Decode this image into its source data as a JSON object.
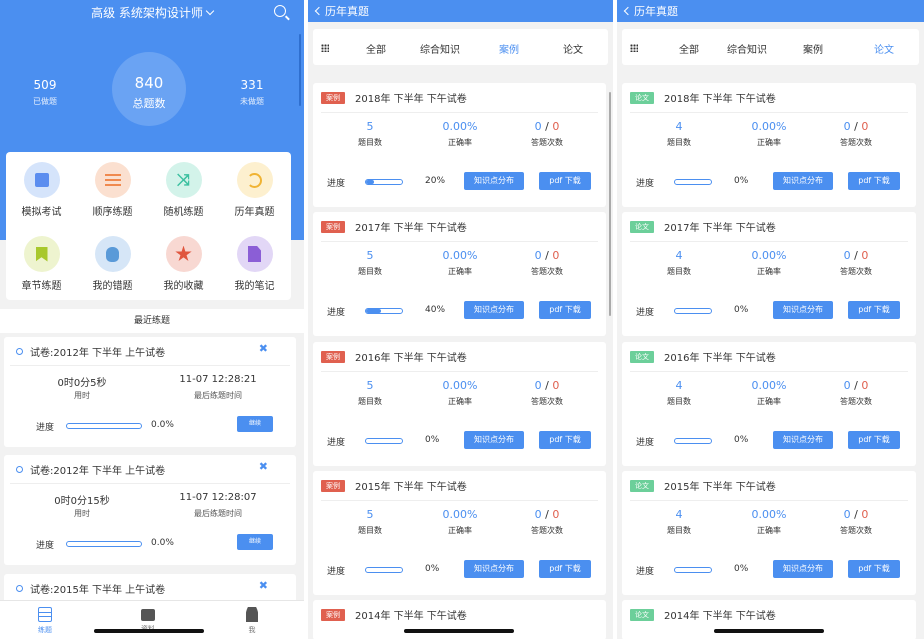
{
  "screen1": {
    "header_title": "高级 系统架构设计师",
    "stats": {
      "total_value": "840",
      "total_label": "总题数",
      "done_value": "509",
      "done_label": "已做题",
      "undone_value": "331",
      "undone_label": "未做题"
    },
    "menu": [
      {
        "label": "模拟考试",
        "icon": "square-icon",
        "bg": "#d5e4fb"
      },
      {
        "label": "顺序练题",
        "icon": "list-icon",
        "bg": "#fbe0d0"
      },
      {
        "label": "随机练题",
        "icon": "shuffle-icon",
        "bg": "#d3f3ea"
      },
      {
        "label": "历年真题",
        "icon": "history-icon",
        "bg": "#fdf0cf"
      },
      {
        "label": "章节练题",
        "icon": "bookmark-icon",
        "bg": "#eef4cf"
      },
      {
        "label": "我的错题",
        "icon": "bug-icon",
        "bg": "#d6e6f7"
      },
      {
        "label": "我的收藏",
        "icon": "star-icon",
        "bg": "#f8d8d2"
      },
      {
        "label": "我的笔记",
        "icon": "doc-icon",
        "bg": "#e2d7f6"
      }
    ],
    "recent_title": "最近练题",
    "recent": [
      {
        "title": "试卷:2012年 下半年 上午试卷",
        "duration": "0时0分5秒",
        "duration_label": "用时",
        "last_time": "11-07 12:28:21",
        "last_label": "最后练题时间",
        "progress_label": "进度",
        "progress": "0.0%",
        "continue_label": "继续"
      },
      {
        "title": "试卷:2012年 下半年 上午试卷",
        "duration": "0时0分15秒",
        "duration_label": "用时",
        "last_time": "11-07 12:28:07",
        "last_label": "最后练题时间",
        "progress_label": "进度",
        "progress": "0.0%",
        "continue_label": "继续"
      },
      {
        "title": "试卷:2015年 下半年 上午试卷"
      }
    ],
    "tabs": [
      {
        "label": "练题",
        "icon": "list-icon",
        "active": true
      },
      {
        "label": "资料",
        "icon": "folder-icon",
        "active": false
      },
      {
        "label": "我",
        "icon": "user-icon",
        "active": false
      }
    ]
  },
  "exam_screens": [
    {
      "back_label": "历年真题",
      "segments": [
        "全部",
        "综合知识",
        "案例",
        "论文"
      ],
      "active_segment": 2,
      "badge": "案例",
      "badge_type": "anli",
      "papers": [
        {
          "title": "2018年 下半年 下午试卷",
          "count": "5",
          "accuracy": "0.00%",
          "answered": "0",
          "total": "0",
          "progress": "20%",
          "progress_value": 0.2
        },
        {
          "title": "2017年 下半年 下午试卷",
          "count": "5",
          "accuracy": "0.00%",
          "answered": "0",
          "total": "0",
          "progress": "40%",
          "progress_value": 0.4
        },
        {
          "title": "2016年 下半年 下午试卷",
          "count": "5",
          "accuracy": "0.00%",
          "answered": "0",
          "total": "0",
          "progress": "0%",
          "progress_value": 0
        },
        {
          "title": "2015年 下半年 下午试卷",
          "count": "5",
          "accuracy": "0.00%",
          "answered": "0",
          "total": "0",
          "progress": "0%",
          "progress_value": 0
        },
        {
          "title": "2014年 下半年 下午试卷"
        }
      ]
    },
    {
      "back_label": "历年真题",
      "segments": [
        "全部",
        "综合知识",
        "案例",
        "论文"
      ],
      "active_segment": 3,
      "badge": "论文",
      "badge_type": "lunwen",
      "papers": [
        {
          "title": "2018年 下半年 下午试卷",
          "count": "4",
          "accuracy": "0.00%",
          "answered": "0",
          "total": "0",
          "progress": "0%",
          "progress_value": 0
        },
        {
          "title": "2017年 下半年 下午试卷",
          "count": "4",
          "accuracy": "0.00%",
          "answered": "0",
          "total": "0",
          "progress": "0%",
          "progress_value": 0
        },
        {
          "title": "2016年 下半年 下午试卷",
          "count": "4",
          "accuracy": "0.00%",
          "answered": "0",
          "total": "0",
          "progress": "0%",
          "progress_value": 0
        },
        {
          "title": "2015年 下半年 下午试卷",
          "count": "4",
          "accuracy": "0.00%",
          "answered": "0",
          "total": "0",
          "progress": "0%",
          "progress_value": 0
        },
        {
          "title": "2014年 下半年 下午试卷"
        }
      ]
    }
  ],
  "labels": {
    "count_label": "题目数",
    "accuracy_label": "正确率",
    "answered_label": "答题次数",
    "progress_label": "进度",
    "kp_button": "知识点分布",
    "pdf_button": "pdf 下载"
  }
}
